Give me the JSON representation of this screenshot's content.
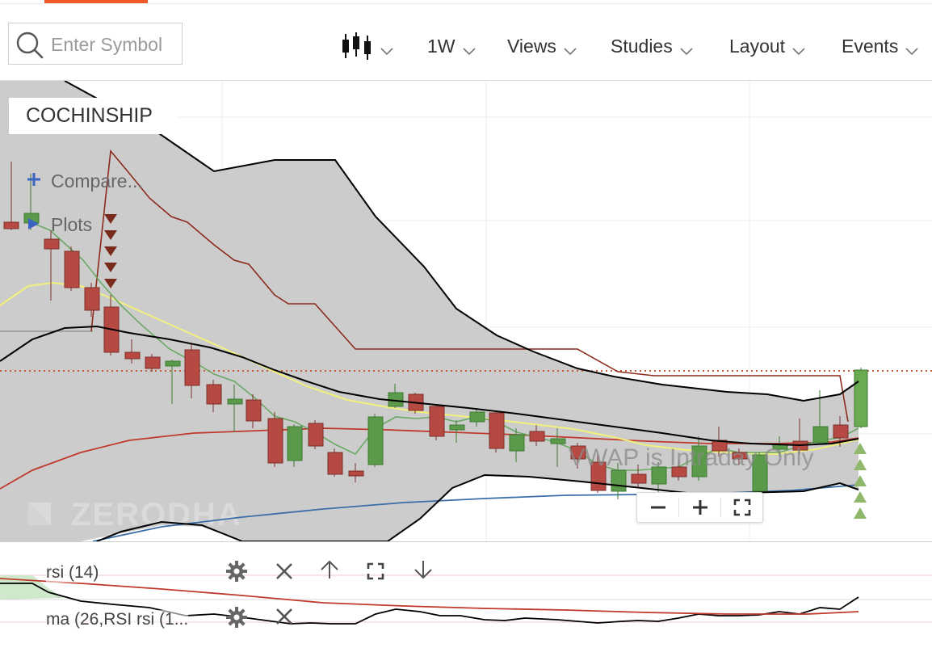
{
  "toolbar": {
    "search": {
      "placeholder": "Enter Symbol",
      "value": ""
    },
    "chart_type_icon": "candlestick-icon",
    "interval": "1W",
    "views": "Views",
    "studies": "Studies",
    "layout": "Layout",
    "events": "Events"
  },
  "chart": {
    "symbol": "COCHINSHIP",
    "compare": "Compare...",
    "plots": "Plots",
    "watermark": "ZERODHA",
    "notice": "VWAP is Intraday Only",
    "colors": {
      "up": "#5a9a4a",
      "down": "#b64a42",
      "bollinger_fill": "#cccccc",
      "band": "#000000",
      "channel": "#8b2b1c",
      "ma_yellow": "#f2f07a",
      "ma_green": "#6aaa64",
      "ma_red": "#c0392b",
      "ma_blue": "#3b6ea8"
    }
  },
  "zoom": {
    "out_icon": "minus-icon",
    "in_icon": "plus-icon",
    "fit_icon": "fullscreen-icon"
  },
  "studies": [
    {
      "label": "rsi (14)",
      "actions": [
        "gear-icon",
        "close-icon",
        "arrow-up-icon",
        "fullscreen-icon",
        "arrow-down-icon"
      ]
    },
    {
      "label": "ma (26,RSI rsi (1...",
      "actions": [
        "gear-icon",
        "close-icon"
      ]
    }
  ]
}
